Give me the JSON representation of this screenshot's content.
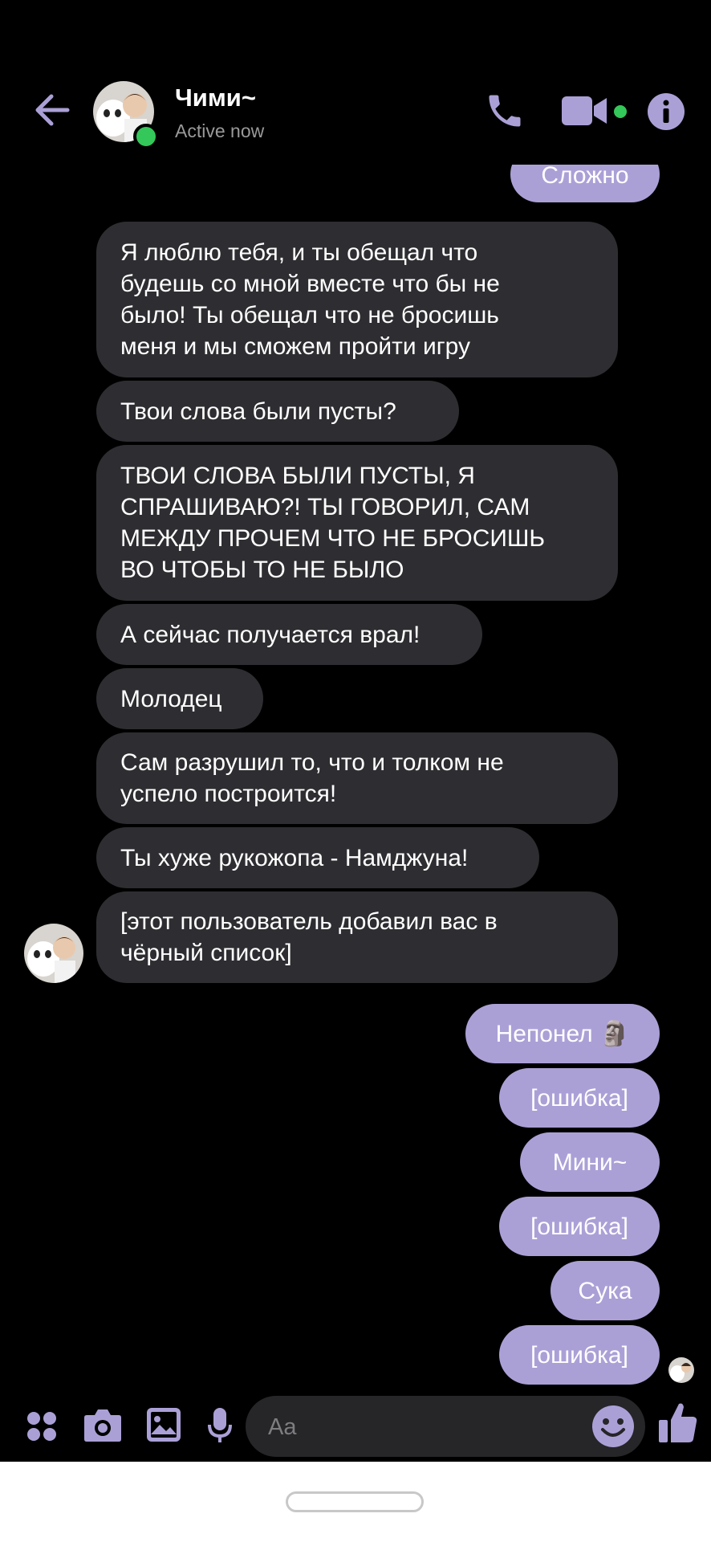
{
  "header": {
    "contact_name": "Чими~",
    "status": "Active now"
  },
  "colors": {
    "accent": "#aba0d6",
    "incoming_bubble": "#2e2d31",
    "online": "#34c759",
    "background": "#000000"
  },
  "messages": [
    {
      "direction": "outgoing",
      "text": "Сложно"
    },
    {
      "direction": "incoming",
      "text": "Я люблю тебя, и ты обещал что\nбудешь со мной вместе что бы не\nбыло! Ты обещал что не бросишь\nменя и мы сможем пройти игру"
    },
    {
      "direction": "incoming",
      "text": "Твои слова были пусты?"
    },
    {
      "direction": "incoming",
      "text": "ТВОИ СЛОВА БЫЛИ ПУСТЫ, Я\nСПРАШИВАЮ?! ТЫ ГОВОРИЛ, САМ\nМЕЖДУ ПРОЧЕМ ЧТО НЕ БРОСИШЬ\nВО ЧТОБЫ ТО НЕ БЫЛО"
    },
    {
      "direction": "incoming",
      "text": "А сейчас получается врал!"
    },
    {
      "direction": "incoming",
      "text": "Молодец"
    },
    {
      "direction": "incoming",
      "text": "Сам разрушил то, что и толком не\nуспело построится!"
    },
    {
      "direction": "incoming",
      "text": "Ты хуже рукожопа - Намджуна!"
    },
    {
      "direction": "incoming",
      "text": "[этот пользователь добавил вас в\nчёрный список]"
    },
    {
      "direction": "outgoing",
      "text": "Непонел 🗿"
    },
    {
      "direction": "outgoing",
      "text": "[ошибка]"
    },
    {
      "direction": "outgoing",
      "text": "Мини~"
    },
    {
      "direction": "outgoing",
      "text": "[ошибка]"
    },
    {
      "direction": "outgoing",
      "text": "Сука"
    },
    {
      "direction": "outgoing",
      "text": "[ошибка]"
    }
  ],
  "composer": {
    "placeholder": "Aa"
  },
  "icons": {
    "back": "arrow-left-icon",
    "call": "phone-icon",
    "video": "video-camera-icon",
    "info": "info-icon",
    "apps": "grid-dots-icon",
    "camera": "camera-icon",
    "gallery": "image-icon",
    "voice": "microphone-icon",
    "emoji": "emoji-icon",
    "like": "thumbs-up-icon"
  }
}
